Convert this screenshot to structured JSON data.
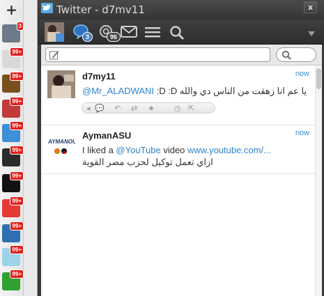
{
  "window": {
    "title": "Twitter - d7mv11",
    "close_label": "x"
  },
  "rail": {
    "add_label": "+",
    "apps": [
      {
        "name": "twitter-app",
        "badge": "3",
        "color": "#6c7a8a"
      },
      {
        "name": "tmv-app",
        "badge": "99+",
        "color": "#d9d9d9"
      },
      {
        "name": "h-app",
        "badge": "99+",
        "color": "#7a4f1e"
      },
      {
        "name": "gj-app",
        "badge": "99+",
        "color": "#c23a3a"
      },
      {
        "name": "grid-app",
        "badge": "99+",
        "color": "#3d8fd6"
      },
      {
        "name": "eye-app",
        "badge": "99+",
        "color": "#2b2b2b"
      },
      {
        "name": "m-app",
        "badge": "99+",
        "color": "#111111"
      },
      {
        "name": "blocks-app",
        "badge": "99+",
        "color": "#e53935"
      },
      {
        "name": "mashable-app",
        "badge": "99+",
        "color": "#2f6fb2"
      },
      {
        "name": "feed-app",
        "badge": "99+",
        "color": "#9cd3e8"
      },
      {
        "name": "techcrunch-app",
        "badge": "99+",
        "color": "#2ea12e"
      }
    ]
  },
  "toolbar": {
    "mentions_badge": "3",
    "messages_badge": "96"
  },
  "tweets": [
    {
      "author": "d7my11",
      "time": "now",
      "mention": "@Mr_ALADWANI",
      "text": " :D :D يا عم انا زهقت من الناس دي والله"
    },
    {
      "author": "AymanASU",
      "time": "now",
      "line1_prefix": "I liked a ",
      "line1_mention": "@YouTube",
      "line1_mid": " video ",
      "line1_link": "www.youtube.com/...",
      "line2": "ازاي تعمل توكيل لحزب مصر القوية"
    }
  ],
  "colors": {
    "accent": "#2e84cf",
    "badge_red": "#e0201c",
    "window_dark": "#3a3a3a"
  }
}
